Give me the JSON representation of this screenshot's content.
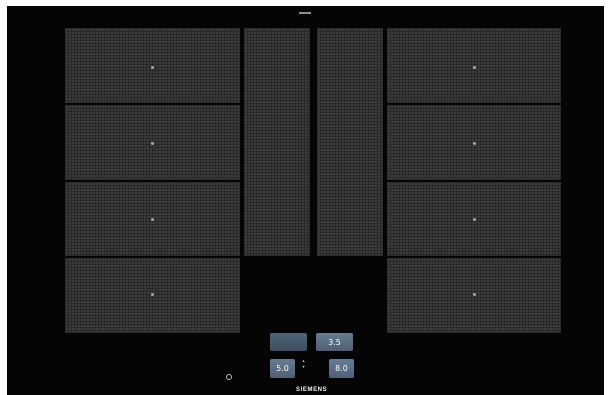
{
  "brand": "SIEMENS",
  "badge_text": "",
  "corner_left_label": "",
  "corner_right_label": "",
  "controls": {
    "left_top": "",
    "right_top": "3.5",
    "left_bottom": "5.0",
    "right_bottom": "8.0"
  },
  "icons": {
    "top_mark": "top-indicator-icon",
    "power": "power-icon",
    "up_arrow": "up-arrow-icon",
    "down_arrow": "down-arrow-icon"
  },
  "colors": {
    "body": "#050505",
    "zone": "#3b3b3b",
    "button_blue": "#667b92"
  }
}
